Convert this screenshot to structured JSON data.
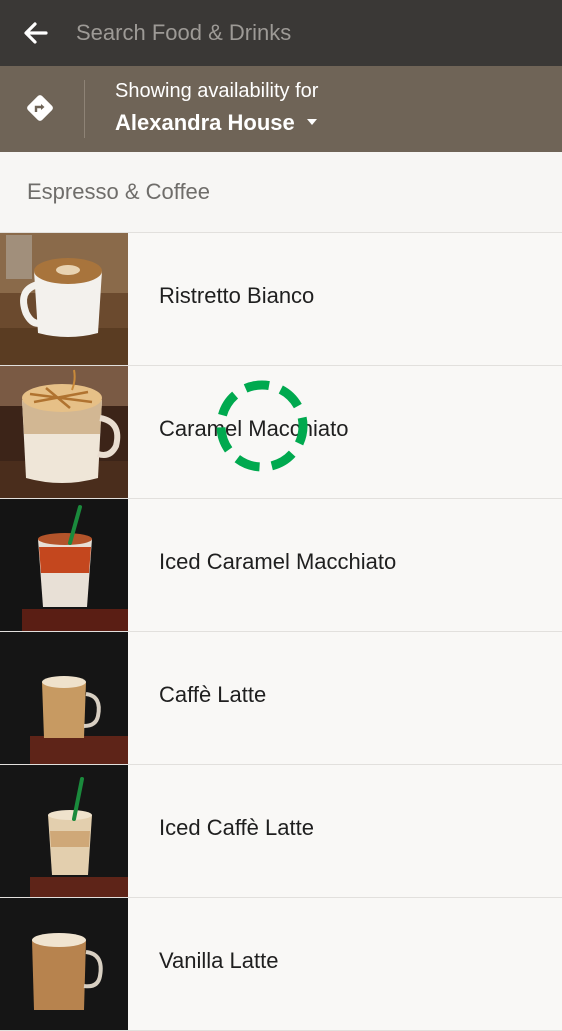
{
  "header": {
    "back_icon": "arrow-left-icon",
    "search_placeholder": "Search Food & Drinks"
  },
  "store": {
    "direction_icon": "directions-icon",
    "line1": "Showing availability for",
    "name": "Alexandra House",
    "dropdown_icon": "caret-down-icon"
  },
  "section": {
    "title": "Espresso & Coffee"
  },
  "items": [
    {
      "name": "Ristretto Bianco"
    },
    {
      "name": "Caramel Macchiato"
    },
    {
      "name": "Iced Caramel Macchiato"
    },
    {
      "name": "Caffè Latte"
    },
    {
      "name": "Iced Caffè Latte"
    },
    {
      "name": "Vanilla Latte"
    }
  ],
  "colors": {
    "topbar": "#3a3836",
    "storebar": "#6f6457",
    "spinner": "#00a94f"
  },
  "loading_indicator": "loading-spinner"
}
